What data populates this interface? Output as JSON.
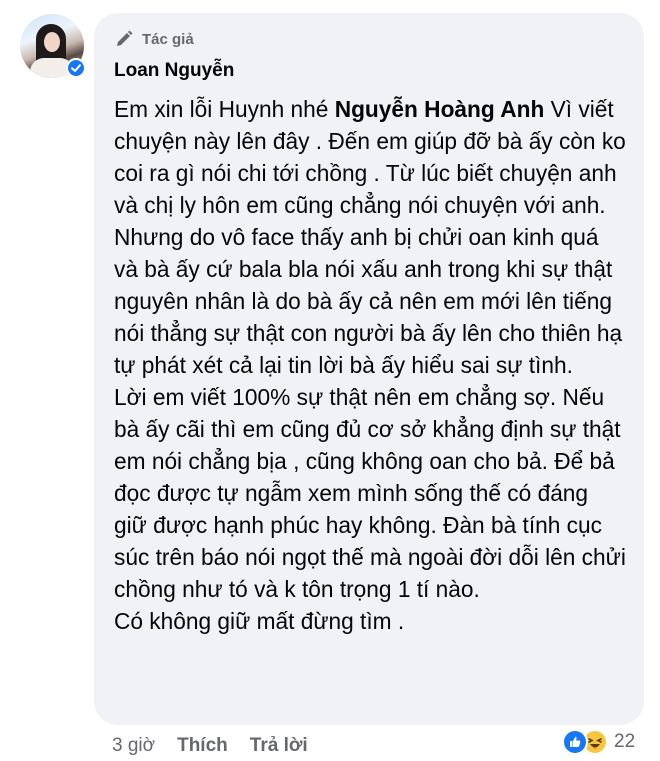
{
  "comment": {
    "badge_label": "Tác giả",
    "author": "Loan Nguyễn",
    "text_intro": "Em xin lỗi Huynh nhé ",
    "mention": "Nguyễn Hoàng Anh",
    "text_para1_rest": " Vì viết chuyện này lên đây . Đến em giúp đỡ bà ấy còn ko coi ra gì nói chi tới chồng . Từ lúc biết chuyện anh và chị ly hôn em cũng chẳng nói chuyện với anh. Nhưng do vô face thấy anh bị chửi oan kinh quá và bà ấy cứ bala bla nói xấu anh trong khi sự thật nguyên nhân là do bà ấy cả nên em mới lên tiếng nói thẳng sự thật con người bà ấy lên cho thiên hạ tự phát xét cả lại tin lời bà ấy hiểu sai sự tình.",
    "text_para2": "Lời em viết 100% sự thật nên em chẳng sợ. Nếu bà ấy cãi thì em cũng đủ cơ sở khẳng định sự thật em nói chẳng bịa , cũng không oan cho bả. Để bả đọc được tự ngẫm xem mình sống thế có đáng giữ được hạnh phúc hay không. Đàn bà tính cục súc trên báo nói ngọt thế mà ngoài đời dỗi lên chửi chồng như tó và k tôn trọng 1 tí nào.",
    "text_para3": "Có không giữ mất đừng tìm ."
  },
  "actions": {
    "time": "3 giờ",
    "like_label": "Thích",
    "reply_label": "Trả lời"
  },
  "reactions": {
    "count": "22",
    "types": [
      "like-icon",
      "haha-icon"
    ]
  },
  "colors": {
    "bubble": "#f0f2f5",
    "secondary_text": "#65676b",
    "accent": "#1877f2"
  }
}
